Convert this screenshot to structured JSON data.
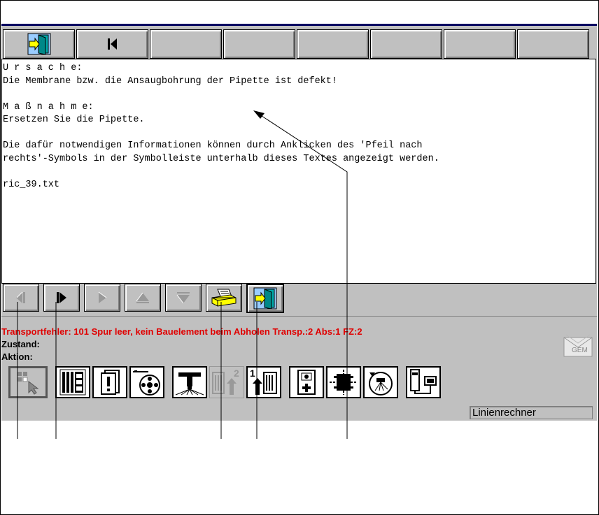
{
  "top_toolbar": {
    "buttons": [
      "exit-door-icon",
      "first-page-icon",
      "",
      "",
      "",
      "",
      "",
      "",
      ""
    ]
  },
  "text_content": {
    "ursache_heading": "U r s a c h e:",
    "ursache_text": "Die Membrane bzw. die Ansaugbohrung der Pipette ist defekt!",
    "massnahme_heading": "M a ß n a h m e:",
    "massnahme_text": "Ersetzen Sie die Pipette.",
    "info_line1": "Die dafür notwendigen Informationen können durch Anklicken des 'Pfeil nach",
    "info_line2": "rechts'-Symbols in der Symbolleiste unterhalb dieses Textes angezeigt werden.",
    "filename": "ric_39.txt"
  },
  "nav_toolbar": [
    "prev-disabled-icon",
    "next-page-icon",
    "arrow-right-disabled-icon",
    "arrow-up-disabled-icon",
    "arrow-down-disabled-icon",
    "printer-icon",
    "exit-door-icon"
  ],
  "status": {
    "error": "Transportfehler: 101  Spur leer, kein Bauelement beim Abholen  Transp.:2  Abs:1  FZ:2",
    "zustand": "Zustand:",
    "aktion": "Aktion:"
  },
  "mail_badge": "GEM",
  "machine_toolbar": [
    "select-grid-icon",
    "film-strip-icon",
    "alert-card-icon",
    "tape-feeder-icon",
    "placement-head-icon",
    "conveyor-2-icon",
    "conveyor-1-icon",
    "camera-icon",
    "component-chip-icon",
    "rotate-nozzle-icon",
    "line-computer-icon"
  ],
  "linienrechner": "Linienrechner",
  "colors": {
    "error": "#e00000",
    "panel": "#c0c0c0",
    "title_line": "#000060"
  }
}
